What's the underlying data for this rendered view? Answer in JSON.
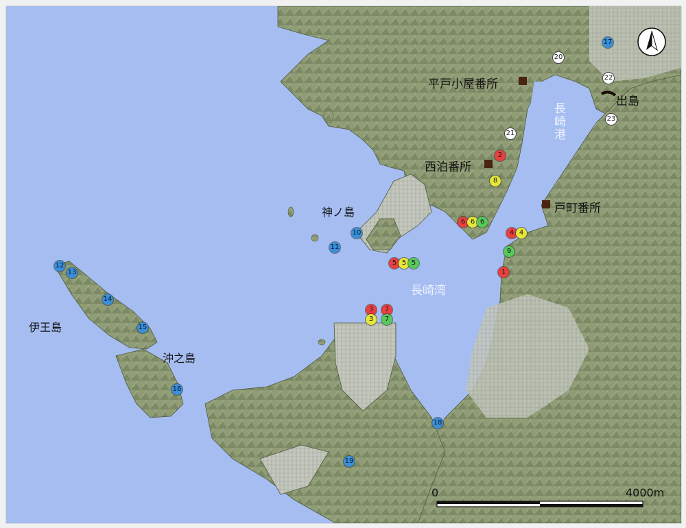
{
  "colors": {
    "sea": "#a6bdf1",
    "land": "#8c9a72",
    "land_dark": "#5d6a4a",
    "urban": "#bfc4ba",
    "marker_red": "#e8403f",
    "marker_yellow": "#e6e63a",
    "marker_green": "#56c95a",
    "marker_blue": "#3b8fd6",
    "guard_post": "#4a2410"
  },
  "places": {
    "hirado": "平戸小屋番所",
    "nishidomari": "西泊番所",
    "tomachi": "戸町番所",
    "dejima": "出島",
    "kaminoshima": "神ノ島",
    "iojima": "伊王島",
    "okinoshima": "沖之島",
    "nagasaki_bay": "長崎湾",
    "nagasaki_port": "長崎港"
  },
  "markers": [
    {
      "label": "1",
      "color": "red"
    },
    {
      "label": "2",
      "color": "red"
    },
    {
      "label": "3",
      "color": "red"
    },
    {
      "label": "7",
      "color": "red"
    },
    {
      "label": "3",
      "color": "yellow"
    },
    {
      "label": "7",
      "color": "green"
    },
    {
      "label": "4",
      "color": "red"
    },
    {
      "label": "4",
      "color": "yellow"
    },
    {
      "label": "5",
      "color": "red"
    },
    {
      "label": "5",
      "color": "yellow"
    },
    {
      "label": "5",
      "color": "green"
    },
    {
      "label": "6",
      "color": "red"
    },
    {
      "label": "6",
      "color": "yellow"
    },
    {
      "label": "6",
      "color": "green"
    },
    {
      "label": "8",
      "color": "yellow"
    },
    {
      "label": "9",
      "color": "green"
    },
    {
      "label": "10",
      "color": "blue"
    },
    {
      "label": "11",
      "color": "blue"
    },
    {
      "label": "12",
      "color": "blue"
    },
    {
      "label": "13",
      "color": "blue"
    },
    {
      "label": "14",
      "color": "blue"
    },
    {
      "label": "15",
      "color": "blue"
    },
    {
      "label": "16",
      "color": "blue"
    },
    {
      "label": "17",
      "color": "blue"
    },
    {
      "label": "18",
      "color": "blue"
    },
    {
      "label": "19",
      "color": "blue"
    },
    {
      "label": "20",
      "color": "white"
    },
    {
      "label": "21",
      "color": "white"
    },
    {
      "label": "22",
      "color": "white"
    },
    {
      "label": "23",
      "color": "white"
    }
  ],
  "scale": {
    "start": "0",
    "end": "4000m"
  },
  "north_icon": "north-arrow-icon"
}
